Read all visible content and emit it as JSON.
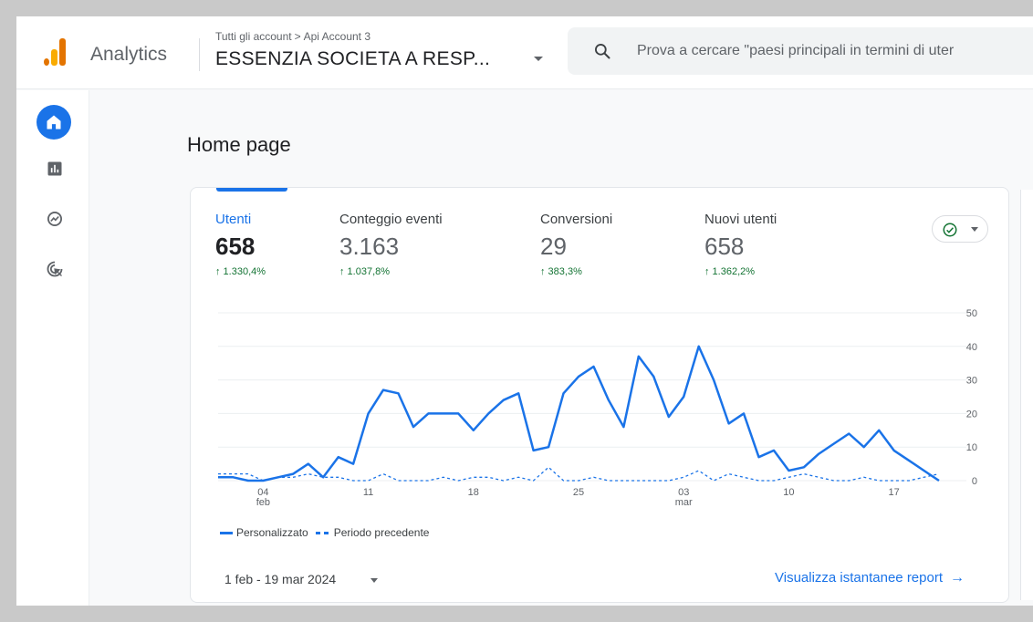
{
  "header": {
    "app_name": "Analytics",
    "breadcrumb": {
      "parent": "Tutti gli account",
      "separator": ">",
      "account": "Api Account 3"
    },
    "property": "ESSENZIA SOCIETA A RESP...",
    "search_placeholder": "Prova a cercare \"paesi principali in termini di uter"
  },
  "nav": {
    "items": [
      "home-icon",
      "reports-icon",
      "explore-icon",
      "advertising-icon"
    ]
  },
  "main": {
    "page_title": "Home page",
    "metrics": [
      {
        "label": "Utenti",
        "value": "658",
        "change": "↑ 1.330,4%"
      },
      {
        "label": "Conteggio eventi",
        "value": "3.163",
        "change": "↑ 1.037,8%"
      },
      {
        "label": "Conversioni",
        "value": "29",
        "change": "↑ 383,3%"
      },
      {
        "label": "Nuovi utenti",
        "value": "658",
        "change": "↑ 1.362,2%"
      }
    ],
    "legend": {
      "current": "Personalizzato",
      "previous": "Periodo precedente"
    },
    "date_range": "1 feb - 19 mar 2024",
    "view_link": "Visualizza istantanee report",
    "colors": {
      "accent": "#1a73e8",
      "positive": "#137333"
    }
  },
  "chart_data": {
    "type": "line",
    "x_tick_labels": [
      {
        "day": 4,
        "label": "04",
        "sub": "feb"
      },
      {
        "day": 11,
        "label": "11",
        "sub": ""
      },
      {
        "day": 18,
        "label": "18",
        "sub": ""
      },
      {
        "day": 25,
        "label": "25",
        "sub": ""
      },
      {
        "day": 32,
        "label": "03",
        "sub": "mar"
      },
      {
        "day": 39,
        "label": "10",
        "sub": ""
      },
      {
        "day": 46,
        "label": "17",
        "sub": ""
      }
    ],
    "y_ticks": [
      0,
      10,
      20,
      30,
      40,
      50
    ],
    "ylim": [
      0,
      50
    ],
    "xlim": [
      1,
      49
    ],
    "grid": true,
    "legend_position": "bottom-left",
    "series": [
      {
        "name": "Personalizzato",
        "style": "solid",
        "x": [
          1,
          2,
          3,
          4,
          5,
          6,
          7,
          8,
          9,
          10,
          11,
          12,
          13,
          14,
          15,
          16,
          17,
          18,
          19,
          20,
          21,
          22,
          23,
          24,
          25,
          26,
          27,
          28,
          29,
          30,
          31,
          32,
          33,
          34,
          35,
          36,
          37,
          38,
          39,
          40,
          41,
          42,
          43,
          44,
          45,
          46,
          47,
          48,
          49
        ],
        "values": [
          1,
          1,
          0,
          0,
          1,
          2,
          5,
          1,
          7,
          5,
          20,
          27,
          26,
          16,
          20,
          20,
          20,
          15,
          20,
          24,
          26,
          9,
          10,
          26,
          31,
          34,
          24,
          16,
          37,
          31,
          19,
          25,
          40,
          30,
          17,
          20,
          7,
          9,
          3,
          4,
          8,
          11,
          14,
          10,
          15,
          9,
          6,
          3,
          0
        ]
      },
      {
        "name": "Periodo precedente",
        "style": "dashed",
        "x": [
          1,
          2,
          3,
          4,
          5,
          6,
          7,
          8,
          9,
          10,
          11,
          12,
          13,
          14,
          15,
          16,
          17,
          18,
          19,
          20,
          21,
          22,
          23,
          24,
          25,
          26,
          27,
          28,
          29,
          30,
          31,
          32,
          33,
          34,
          35,
          36,
          37,
          38,
          39,
          40,
          41,
          42,
          43,
          44,
          45,
          46,
          47,
          48,
          49
        ],
        "values": [
          2,
          2,
          2,
          0,
          1,
          1,
          2,
          1,
          1,
          0,
          0,
          2,
          0,
          0,
          0,
          1,
          0,
          1,
          1,
          0,
          1,
          0,
          4,
          0,
          0,
          1,
          0,
          0,
          0,
          0,
          0,
          1,
          3,
          0,
          2,
          1,
          0,
          0,
          1,
          2,
          1,
          0,
          0,
          1,
          0,
          0,
          0,
          1,
          2
        ]
      }
    ]
  }
}
